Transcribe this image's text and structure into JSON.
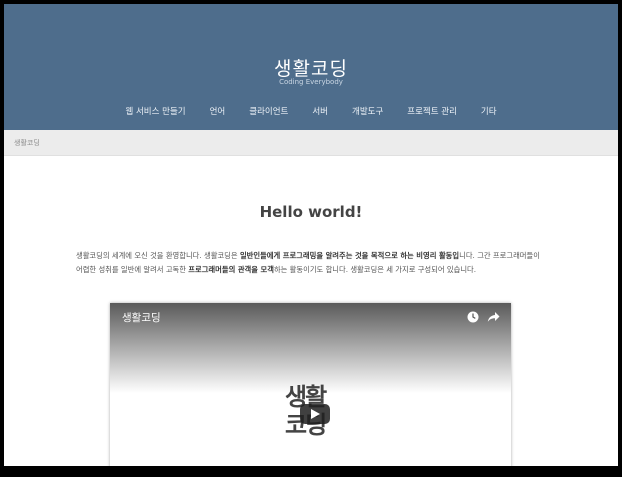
{
  "header": {
    "site_title": "생활코딩",
    "site_subtitle": "Coding Everybody",
    "nav": [
      "웹 서비스 만들기",
      "언어",
      "클라이언트",
      "서버",
      "개발도구",
      "프로젝트 관리",
      "기타"
    ]
  },
  "breadcrumb": "생활코딩",
  "post": {
    "title": "Hello world!",
    "body_1": "생활코딩의 세계에 오신 것을 환영합니다. 생활코딩은 ",
    "body_b1": "일반인들에게 프로그래밍을 알려주는 것을 목적으로 하는 비영리 활동입",
    "body_2": "니다. 그간 프로그래머들이 어렵한 성취를 일반에 알려서 고독한 ",
    "body_b2": "프로그래머들의 관객을 모객",
    "body_3": "하는 활동이기도 합니다. 생활코딩은 세 가지로 구성되어 있습니다."
  },
  "video": {
    "title": "생활코딩",
    "logo_line1": "생활",
    "logo_line2": "코딩",
    "icons": [
      "clock-icon",
      "share-icon",
      "play-icon"
    ]
  },
  "colors": {
    "header_bg": "#4e6d8c",
    "crumb_bg": "#ececec"
  }
}
